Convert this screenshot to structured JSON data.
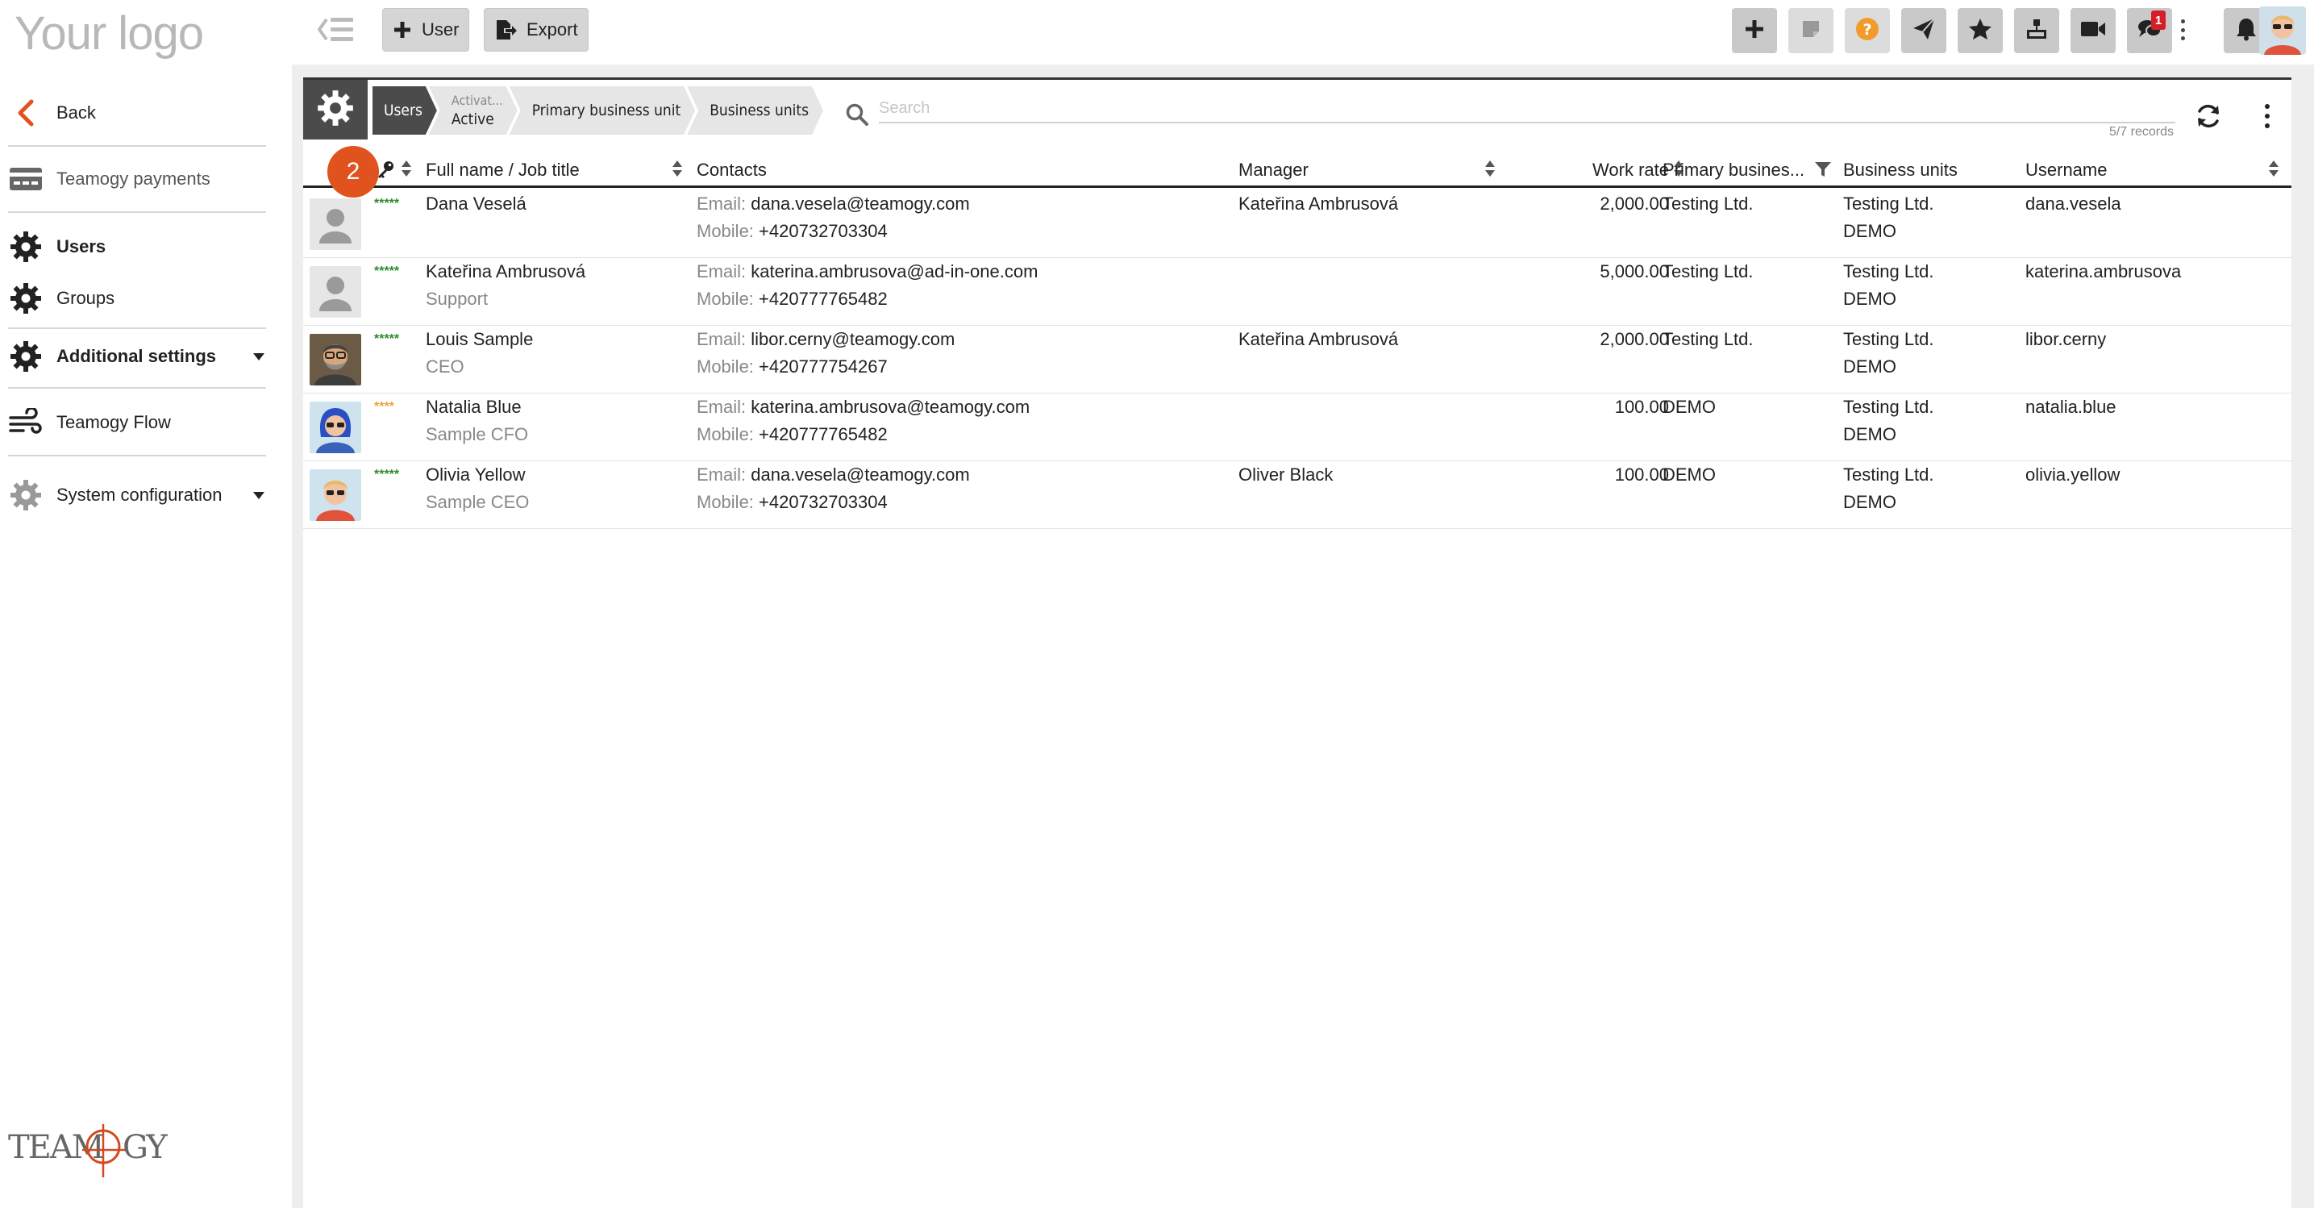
{
  "app": {
    "logo_text": "Your logo",
    "brand_text": "TEAMOGY"
  },
  "sidebar": {
    "items": [
      {
        "label": "Back",
        "icon": "chevron-left-icon"
      },
      {
        "label": "Teamogy payments",
        "icon": "payment-card-icon"
      },
      {
        "label": "Users",
        "icon": "gear-icon"
      },
      {
        "label": "Groups",
        "icon": "gear-icon"
      },
      {
        "label": "Additional settings",
        "icon": "gear-icon"
      },
      {
        "label": "Teamogy Flow",
        "icon": "wind-flow-icon"
      },
      {
        "label": "System configuration",
        "icon": "gear-icon"
      }
    ]
  },
  "toolbar": {
    "user_label": "User",
    "export_label": "Export",
    "notification_count": "1",
    "icons": [
      "plus-icon",
      "sticky-note-icon",
      "help-icon",
      "send-icon",
      "star-icon",
      "sitemap-icon",
      "video-icon",
      "chat-icon",
      "bell-icon"
    ]
  },
  "breadcrumb": {
    "users": "Users",
    "activation_label": "Activat...",
    "activation_value": "Active",
    "primary_bu": "Primary business unit",
    "business_units": "Business units"
  },
  "search": {
    "placeholder": "Search",
    "records": "5/7 records"
  },
  "step_badge": "2",
  "table": {
    "headers": {
      "name": "Full name / Job title",
      "contacts": "Contacts",
      "manager": "Manager",
      "work_rate": "Work rate",
      "primary_bu": "Primary busines...",
      "business_units": "Business units",
      "username": "Username"
    },
    "email_label": "Email:",
    "mobile_label": "Mobile:",
    "rows": [
      {
        "stars": "*****",
        "name": "Dana Veselá",
        "job": "",
        "email": "dana.vesela@teamogy.com",
        "mobile": "+420732703304",
        "manager": "Kateřina Ambrusová",
        "work_rate": "2,000.00",
        "primary_bu": "Testing Ltd.",
        "bu1": "Testing Ltd.",
        "bu2": "DEMO",
        "username": "dana.vesela"
      },
      {
        "stars": "*****",
        "name": "Kateřina Ambrusová",
        "job": "Support",
        "email": "katerina.ambrusova@ad-in-one.com",
        "mobile": "+420777765482",
        "manager": "",
        "work_rate": "5,000.00",
        "primary_bu": "Testing Ltd.",
        "bu1": "Testing Ltd.",
        "bu2": "DEMO",
        "username": "katerina.ambrusova"
      },
      {
        "stars": "*****",
        "name": "Louis Sample",
        "job": "CEO",
        "email": "libor.cerny@teamogy.com",
        "mobile": "+420777754267",
        "manager": "Kateřina Ambrusová",
        "work_rate": "2,000.00",
        "primary_bu": "Testing Ltd.",
        "bu1": "Testing Ltd.",
        "bu2": "DEMO",
        "username": "libor.cerny"
      },
      {
        "stars": "****",
        "name": "Natalia Blue",
        "job": "Sample CFO",
        "email": "katerina.ambrusova@teamogy.com",
        "mobile": "+420777765482",
        "manager": "",
        "work_rate": "100.00",
        "primary_bu": "DEMO",
        "bu1": "Testing Ltd.",
        "bu2": "DEMO",
        "username": "natalia.blue"
      },
      {
        "stars": "*****",
        "name": "Olivia Yellow",
        "job": "Sample CEO",
        "email": "dana.vesela@teamogy.com",
        "mobile": "+420732703304",
        "manager": "Oliver Black",
        "work_rate": "100.00",
        "primary_bu": "DEMO",
        "bu1": "Testing Ltd.",
        "bu2": "DEMO",
        "username": "olivia.yellow"
      }
    ]
  },
  "colors": {
    "accent_orange": "#e0531f",
    "star_green": "#2e8b2e",
    "star_orange": "#f0a13a",
    "badge_red": "#d21f2a",
    "dark_tile": "#4b4b4b"
  }
}
